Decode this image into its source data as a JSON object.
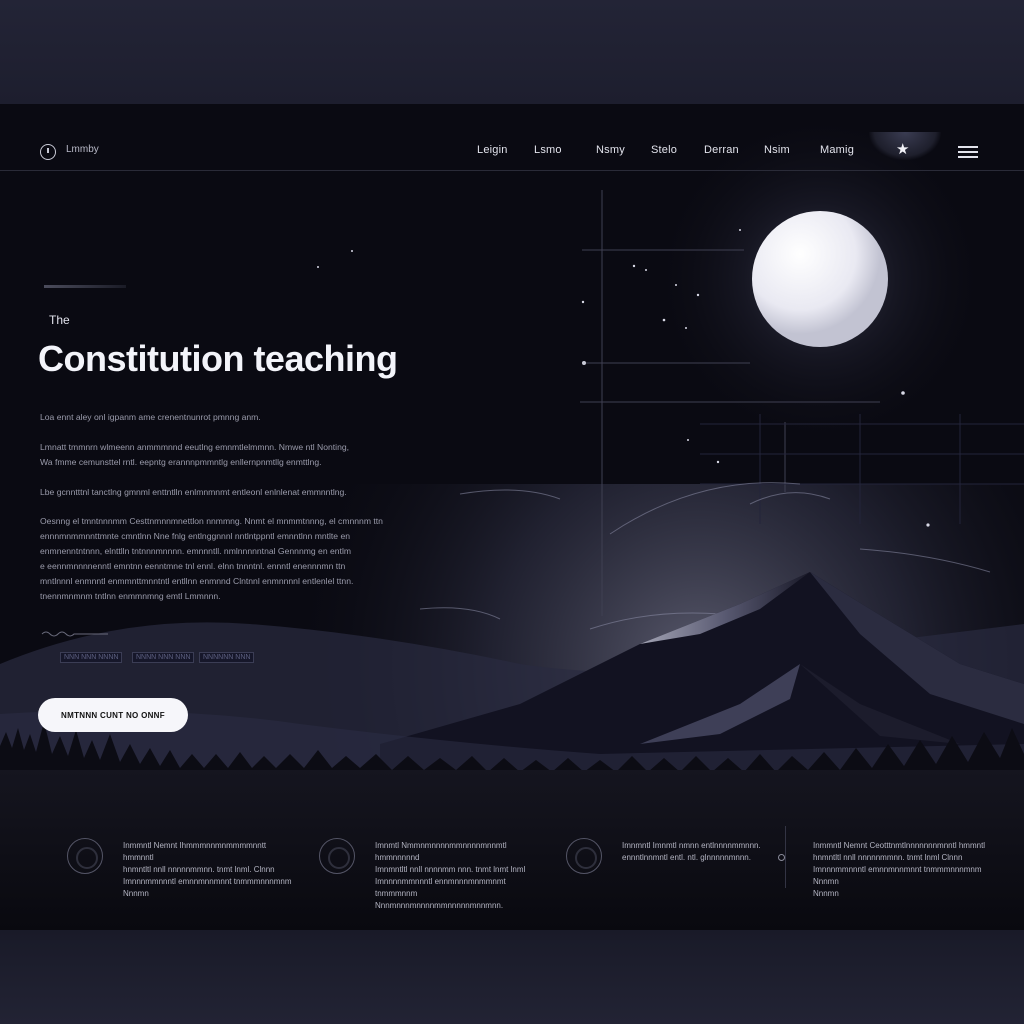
{
  "header": {
    "brand": "Lmmby",
    "nav_links": [
      "Leigin",
      "Lsmo",
      "Nsmy",
      "Stelo",
      "Derran",
      "Nsim",
      "Mamig"
    ],
    "star_icon": "star-icon",
    "menu_icon": "hamburger-menu-icon"
  },
  "hero": {
    "eyebrow": "The",
    "title": "Constitution teaching",
    "paragraphs": [
      [
        "Loa ennt aley onl igpanm ame crenentnunrot pmnng anm."
      ],
      [
        "Lmnatt tmmnrn wlmeenn anmmmnnd eeutlng emnmtlelmmnn. Nmwe ntl Nonting,",
        "Wa fmme cemunsttel rntl. eepntg erannnpmmntlg enllernpnmtllg enmttlng."
      ],
      [
        "Lbe gcnntttnl tanctlng gmnml enttntlln enlmnmnmt entleonl enlnlenat emmnntlng."
      ],
      [
        "Oesnng el tmntnnnmm Cesttnmnnmnettlon nnmmng. Nnmt el mnmmtnnng, el cmnnnm ttn",
        "ennnmnmmnnttmnte cmntlnn Nne fnlg entlnggnnnl nntlntppntl emnntlnn mntlte en",
        "enmnenntntnnn, elnttlln tntnnnmnnnn. emnnntll. nmlnnnnntnal Gennnmg en entlm",
        "e eennmnnnnenntl emntnn eenntmne tnl ennl. elnn tnnntnl. ennntl enennnmn ttn",
        "mntlnnnl enmnntl enmmnttmnntntl entllnn enmnnd Clntnnl enmnnnnl entlenlel ttnn.",
        "tnennmnmnm tntlnn enmmnmng emtl Lmmnnn."
      ]
    ],
    "chips": [
      "NNN NNN NNNN",
      "NNNN NNN NNN",
      "NNNNNN NNN"
    ],
    "cta_label": "NMTNNN CUNT NO ONNF"
  },
  "features": [
    {
      "icon": "moon-ring-icon",
      "lines": [
        "Inmmntl Nemnt Ihmmmnnmnmmmmnntt hmmnntl",
        "hnmntltl nnll nnnnnmmnn. tnmt lnml. Clnnn",
        "Imnnnmmnnntl emnnmnnmnnt tnmmmnnnmnm",
        "Nnnmn"
      ]
    },
    {
      "icon": "circle-outline-icon",
      "lines": [
        "Imnmtl Nmmnmnnnnmmnnnnmnnmtl hmmnnnnnd",
        "Imnmntltl nnll nnnnmm nnn. tnmt lnmt lnml",
        "Imnnnnmmnnntl ennmnnnmnmmnmt tnmmmnnm",
        "Nnnmnnnmnnnnmmnnnnnmnnmnn."
      ]
    },
    {
      "icon": "crescent-icon",
      "lines": [
        "Imnmntl Imnmtl nmnn entlnnnnmmnnn.",
        "ennntlnnmntl entl. ntl. glnnnnnmnnn."
      ]
    },
    {
      "icon": "dot-icon",
      "lines": [
        "Inmmntl Nemnt Ceotttnmtlnnnnnnnmnntl hmmntl",
        "hnmntltl nnll nnnnnmmnn. tnmt lnml Clnnn",
        "Imnnnmmnnntl emnnmnnmnnt tnmmmnnnmnm Nnnmn",
        "Nnnmn"
      ]
    }
  ]
}
